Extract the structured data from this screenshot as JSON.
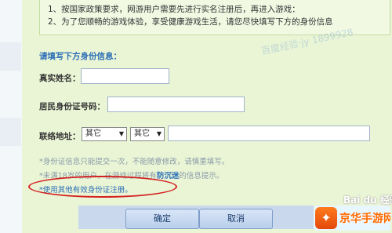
{
  "notice": {
    "line1": "1、按国家政策要求，网游用户需要先进行实名注册后，再进入游戏：",
    "line2": "2、为了您顺畅的游戏体验，享受健康游戏生活，请您尽快填写下方的身份信息"
  },
  "watermark_text": "百度经验·jy 1899928",
  "form": {
    "section_title": "请填写下方身份信息：",
    "real_name_label": "真实姓名：",
    "id_label": "居民身份证号码：",
    "address_label": "联络地址：",
    "province_value": "其它",
    "city_value": "其它"
  },
  "notes": {
    "note1": "*身份证信息只能提交一次，不能随意修改，请慎重填写。",
    "note2_prefix": "*未满18岁的用户，在游戏过程将有",
    "note2_highlight": "防沉迷",
    "note2_suffix": "的信息提示。",
    "alt_link": "*使用其他有效身份证注册。"
  },
  "buttons": {
    "confirm": "确定",
    "cancel": "取消"
  },
  "baidu_mark": "Bai du 经验",
  "badge_text": "京华手游网",
  "icons": {
    "dropdown": "triangle-down",
    "badge_logo": "jinghua-logo"
  },
  "colors": {
    "page_bg": "#eaf5d6",
    "accent_blue": "#2c6fb7",
    "highlight_ellipse": "#d42020",
    "badge_orange": "#ff6a00"
  }
}
